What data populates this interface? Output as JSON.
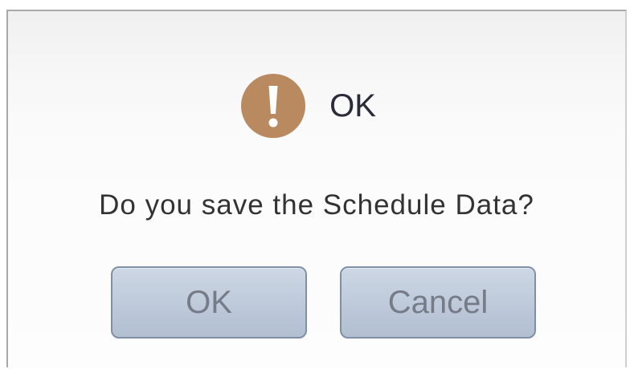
{
  "dialog": {
    "title": "OK",
    "icon": "exclamation-icon",
    "icon_color": "#b98a60",
    "message": "Do you save the Schedule Data?",
    "buttons": {
      "ok_label": "OK",
      "cancel_label": "Cancel"
    }
  }
}
